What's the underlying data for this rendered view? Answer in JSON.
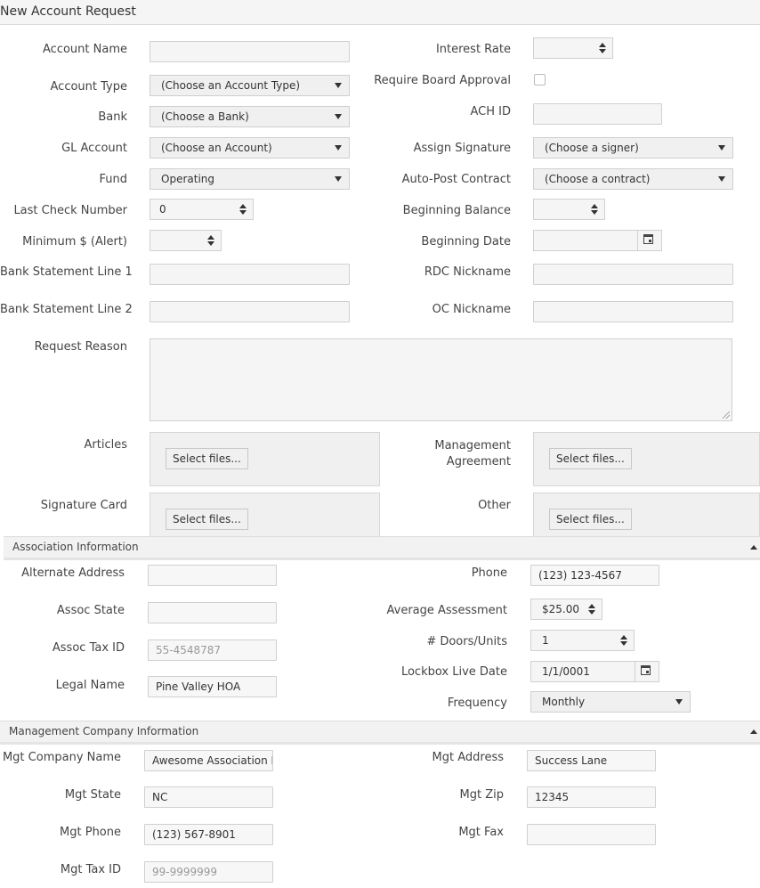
{
  "title": "New Account Request",
  "form": {
    "account_name": {
      "label": "Account Name",
      "value": ""
    },
    "interest_rate": {
      "label": "Interest Rate",
      "value": ""
    },
    "account_type": {
      "label": "Account Type",
      "value": "(Choose an Account Type)"
    },
    "require_board_approval": {
      "label": "Require Board Approval",
      "checked": false
    },
    "bank": {
      "label": "Bank",
      "value": "(Choose a Bank)"
    },
    "ach_id": {
      "label": "ACH ID",
      "value": ""
    },
    "gl_account": {
      "label": "GL Account",
      "value": "(Choose an Account)"
    },
    "assign_signature": {
      "label": "Assign Signature",
      "value": "(Choose a signer)"
    },
    "fund": {
      "label": "Fund",
      "value": "Operating"
    },
    "auto_post_contract": {
      "label": "Auto-Post Contract",
      "value": "(Choose a contract)"
    },
    "last_check_number": {
      "label": "Last Check Number",
      "value": "0"
    },
    "beginning_balance": {
      "label": "Beginning Balance",
      "value": ""
    },
    "minimum_alert": {
      "label": "Minimum $ (Alert)",
      "value": ""
    },
    "beginning_date": {
      "label": "Beginning Date",
      "value": ""
    },
    "bank_statement_line1": {
      "label": "Bank Statement Line 1",
      "value": ""
    },
    "rdc_nickname": {
      "label": "RDC Nickname",
      "value": ""
    },
    "bank_statement_line2": {
      "label": "Bank Statement Line 2",
      "value": ""
    },
    "oc_nickname": {
      "label": "OC Nickname",
      "value": ""
    },
    "request_reason": {
      "label": "Request Reason",
      "value": ""
    }
  },
  "uploads": {
    "button_label": "Select files...",
    "articles": "Articles",
    "management_agreement": "Management Agreement",
    "signature_card": "Signature Card",
    "other": "Other"
  },
  "association": {
    "header": "Association Information",
    "alternate_address": {
      "label": "Alternate Address",
      "value": ""
    },
    "phone": {
      "label": "Phone",
      "value": "(123) 123-4567"
    },
    "assoc_state": {
      "label": "Assoc State",
      "value": ""
    },
    "average_assessment": {
      "label": "Average Assessment",
      "value": "$25.00"
    },
    "assoc_tax_id": {
      "label": "Assoc Tax ID",
      "value": "55-4548787"
    },
    "doors_units": {
      "label": "# Doors/Units",
      "value": "1"
    },
    "lockbox_live_date": {
      "label": "Lockbox Live Date",
      "value": "1/1/0001"
    },
    "legal_name": {
      "label": "Legal Name",
      "value": "Pine Valley HOA"
    },
    "frequency": {
      "label": "Frequency",
      "value": "Monthly"
    }
  },
  "management": {
    "header": "Management Company Information",
    "company_name": {
      "label": "Mgt Company Name",
      "value": "Awesome Association Management"
    },
    "address": {
      "label": "Mgt Address",
      "value": "Success Lane"
    },
    "state": {
      "label": "Mgt State",
      "value": "NC"
    },
    "zip": {
      "label": "Mgt Zip",
      "value": "12345"
    },
    "phone": {
      "label": "Mgt Phone",
      "value": "(123) 567-8901"
    },
    "fax": {
      "label": "Mgt Fax",
      "value": ""
    },
    "tax_id": {
      "label": "Mgt Tax ID",
      "value": "99-9999999"
    }
  }
}
